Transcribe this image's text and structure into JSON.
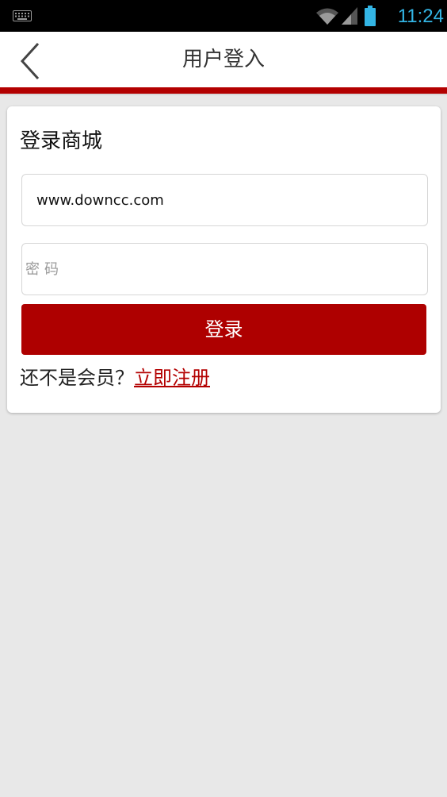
{
  "status_bar": {
    "time": "11:24",
    "icons": [
      "keyboard-icon",
      "wifi-icon",
      "signal-icon",
      "battery-icon"
    ],
    "accent_color": "#33b5e5"
  },
  "header": {
    "title": "用户登入",
    "back_icon": "chevron-left-icon",
    "rule_color": "#b30000"
  },
  "login": {
    "title": "登录商城",
    "username_value": "www.downcc.com",
    "password_placeholder": "密码",
    "submit_label": "登录",
    "submit_color": "#ae0000",
    "register_prompt": "还不是会员？",
    "register_link": "立即注册"
  }
}
